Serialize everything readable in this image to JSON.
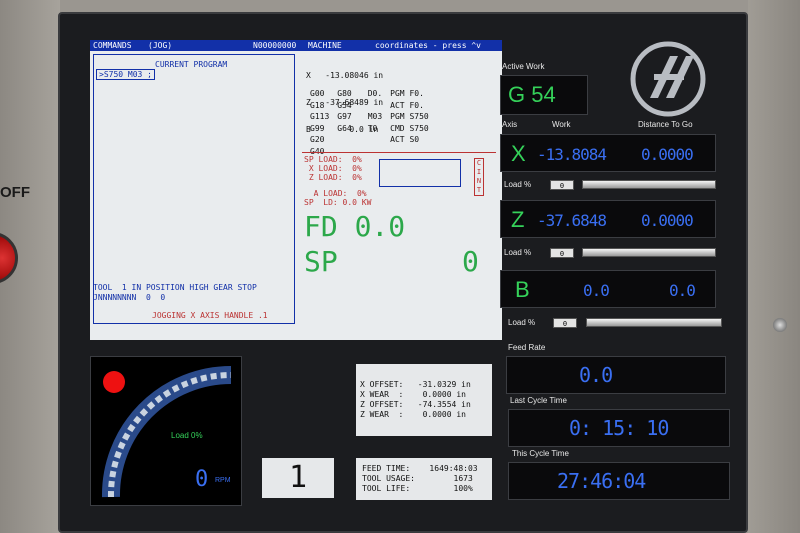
{
  "panel": {
    "off_label": "OFF"
  },
  "screen": {
    "topbar": {
      "commands": "COMMANDS",
      "mode": "(JOG)",
      "program": "N00000000",
      "machine": "MACHINE",
      "coords_hint": "coordinates - press ^v"
    },
    "current_program_title": "CURRENT PROGRAM",
    "current_program_line": ">S750 M03 ;",
    "coords": [
      {
        "axis": "X",
        "value": "-13.08046 in"
      },
      {
        "axis": "Z",
        "value": "-37.68489 in"
      },
      {
        "axis": "B",
        "value": "0.0 in"
      }
    ],
    "gcodes": [
      [
        "G00",
        "G80",
        "",
        "D0.",
        "PGM F0."
      ],
      [
        "G18",
        "G54",
        "",
        "",
        "ACT F0."
      ],
      [
        "G113",
        "G97",
        "",
        "M03",
        "PGM S750"
      ],
      [
        "G99",
        "G64",
        "",
        "T0",
        "CMD S750"
      ],
      [
        "G20",
        "",
        "",
        "",
        "ACT S0"
      ],
      [
        "G40",
        "",
        "",
        "",
        ""
      ]
    ],
    "loads": {
      "sp": "SP LOAD:  0%",
      "x": " X LOAD:  0%",
      "z": " Z LOAD:  0%",
      "a": "  A LOAD:  0%",
      "sp_kw": "SP  LD: 0.0 KW",
      "side": [
        "C",
        "I",
        "N",
        "T"
      ]
    },
    "fd": "FD 0.0",
    "sp": "SP",
    "sp_value": "0",
    "tool_status": "TOOL  1 IN POSITION HIGH GEAR STOP",
    "tool_codes": "JNNNNNNNN  0  0",
    "message": "JOGGING X  AXIS HANDLE .1"
  },
  "right": {
    "active_work_label": "Active Work",
    "active_work_value": "G 54",
    "axis_label": "Axis",
    "work_label": "Work",
    "dtg_label": "Distance To Go",
    "axes": [
      {
        "name": "X",
        "work": "-13.8084",
        "dtg": "0.0000",
        "load_label": "Load %",
        "load": "0",
        "load_fraction": 0.0
      },
      {
        "name": "Z",
        "work": "-37.6848",
        "dtg": "0.0000",
        "load_label": "Load %",
        "load": "0",
        "load_fraction": 0.0
      },
      {
        "name": "B",
        "work": "0.0",
        "dtg": "0.0",
        "load_label": "Load %",
        "load": "0",
        "load_fraction": 0.0
      }
    ],
    "feed_rate_label": "Feed Rate",
    "feed_rate_value": "0.0",
    "last_cycle_label": "Last Cycle Time",
    "last_cycle_value": "0: 15: 10",
    "this_cycle_label": "This Cycle Time",
    "this_cycle_value": "27:46:04"
  },
  "bottom": {
    "spindle_load": "Load 0%",
    "rpm_value": "0",
    "rpm_label": "RPM",
    "tool_number": "1",
    "offsets": [
      "X OFFSET:   -31.0329 in",
      "X WEAR  :    0.0000 in",
      "Z OFFSET:   -74.3554 in",
      "Z WEAR  :    0.0000 in"
    ],
    "feed_info": [
      "FEED TIME:    1649:48:03",
      "TOOL USAGE:        1673",
      "TOOL LIFE:         100%"
    ]
  },
  "colors": {
    "accent_blue": "#3a6ff2",
    "accent_green": "#35d25a",
    "title_bar": "#1230a8",
    "alarm_red": "#e11"
  },
  "icons": {
    "logo": "haas-logo-icon",
    "spindle_dial": "spindle-gauge-icon",
    "status_light": "status-light-icon"
  }
}
